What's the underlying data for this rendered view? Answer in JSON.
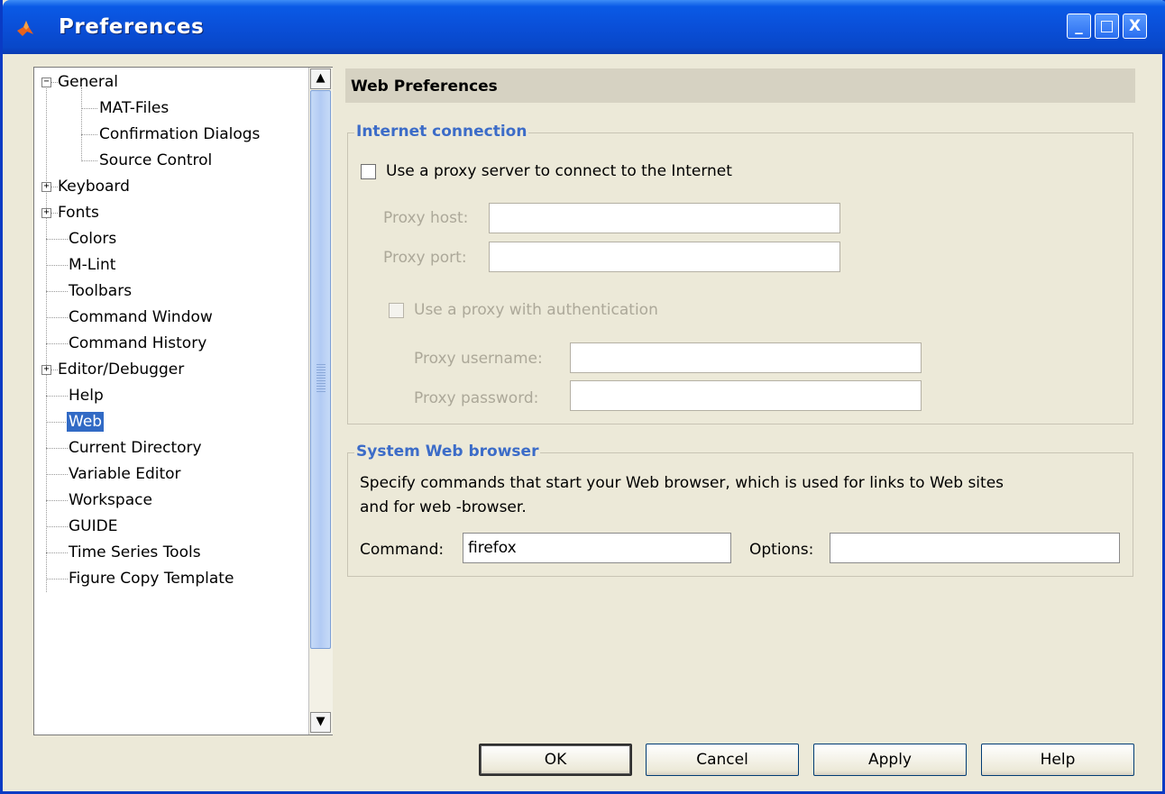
{
  "window": {
    "title": "Preferences",
    "minimize_label": "_",
    "maximize_label": "□",
    "close_label": "X"
  },
  "tree": {
    "nodes": [
      {
        "label": "General",
        "toggle": "−"
      },
      {
        "label": "MAT-Files"
      },
      {
        "label": "Confirmation Dialogs"
      },
      {
        "label": "Source Control"
      },
      {
        "label": "Keyboard",
        "toggle": "+"
      },
      {
        "label": "Fonts",
        "toggle": "+"
      },
      {
        "label": "Colors"
      },
      {
        "label": "M-Lint"
      },
      {
        "label": "Toolbars"
      },
      {
        "label": "Command Window"
      },
      {
        "label": "Command History"
      },
      {
        "label": "Editor/Debugger",
        "toggle": "+"
      },
      {
        "label": "Help"
      },
      {
        "label": "Web",
        "selected": true
      },
      {
        "label": "Current Directory"
      },
      {
        "label": "Variable Editor"
      },
      {
        "label": "Workspace"
      },
      {
        "label": "GUIDE"
      },
      {
        "label": "Time Series Tools"
      },
      {
        "label": "Figure Copy Template"
      }
    ],
    "scroll_up": "▲",
    "scroll_down": "▼"
  },
  "panel": {
    "header": "Web Preferences",
    "internet": {
      "title": "Internet connection",
      "use_proxy_label": "Use a proxy server to connect to the Internet",
      "use_proxy_checked": false,
      "proxy_host_label": "Proxy host:",
      "proxy_host_value": "",
      "proxy_port_label": "Proxy port:",
      "proxy_port_value": "",
      "use_auth_label": "Use a proxy with authentication",
      "use_auth_checked": false,
      "proxy_username_label": "Proxy username:",
      "proxy_username_value": "",
      "proxy_password_label": "Proxy password:",
      "proxy_password_value": ""
    },
    "browser": {
      "title": "System Web browser",
      "description_line1": "Specify commands that start your Web browser, which is used for links to Web sites",
      "description_line2": "and for web -browser.",
      "command_label": "Command:",
      "command_value": "firefox",
      "options_label": "Options:",
      "options_value": ""
    }
  },
  "buttons": {
    "ok": "OK",
    "cancel": "Cancel",
    "apply": "Apply",
    "help": "Help"
  },
  "colors": {
    "title_bar": "#0a4fd8",
    "selection": "#316ac5",
    "group_title": "#3c6cc8",
    "dialog_bg": "#ece9d8"
  }
}
